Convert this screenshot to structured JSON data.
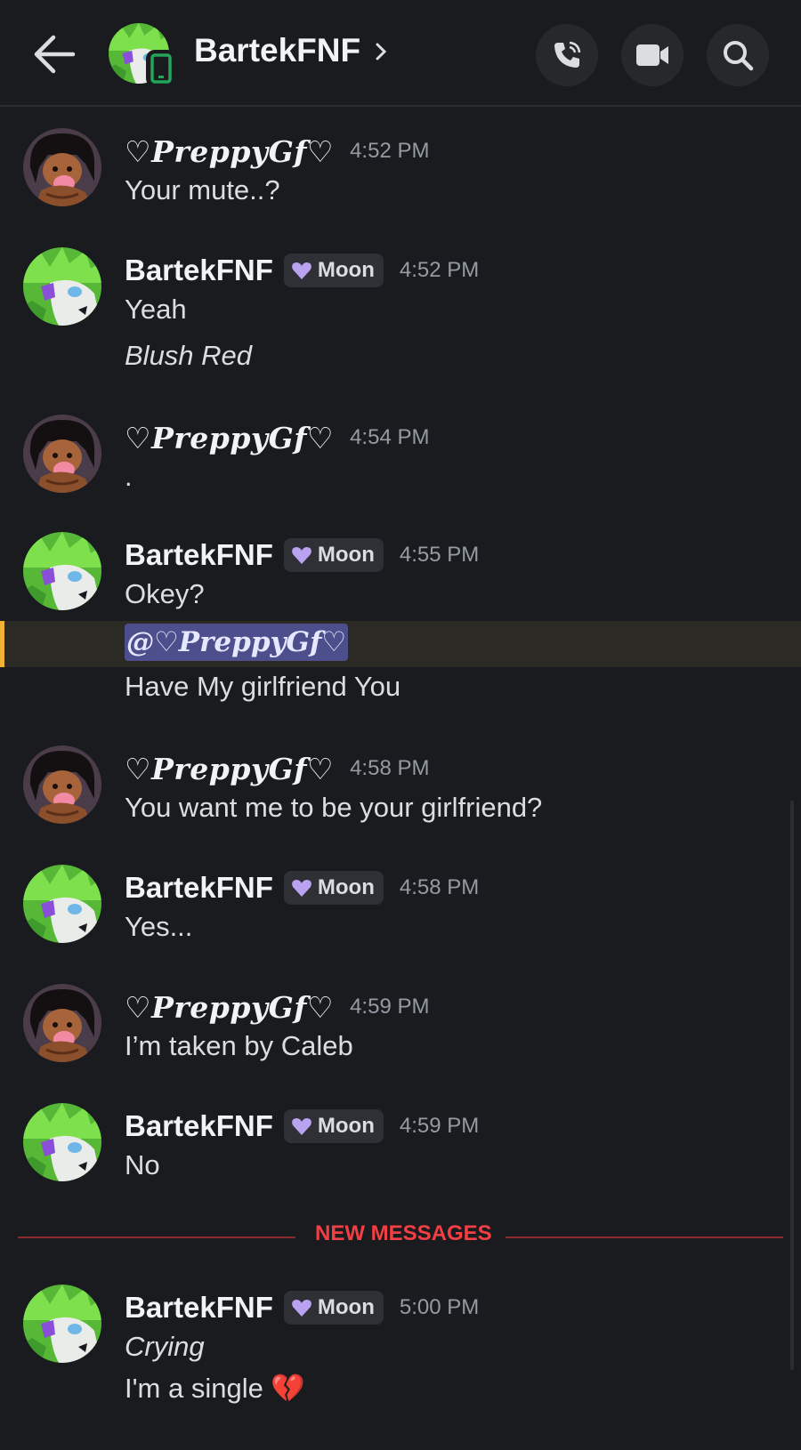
{
  "header": {
    "channel_name": "BartekFNF",
    "back_icon": "arrow-left-icon",
    "chevron_icon": "chevron-right-icon",
    "actions": [
      "voice-call-icon",
      "video-call-icon",
      "search-icon"
    ]
  },
  "users": {
    "preppy": {
      "name": "♡PreppyGf♡"
    },
    "bartek": {
      "name": "BartekFNF",
      "tag": "Moon"
    }
  },
  "messages": [
    {
      "author": "♡PreppyGf♡",
      "time": "4:52 PM",
      "lines": [
        "Your mute..?"
      ]
    },
    {
      "author": "BartekFNF",
      "tag": "Moon",
      "time": "4:52 PM",
      "lines": [
        "Yeah",
        "Blush Red"
      ]
    },
    {
      "author": "♡PreppyGf♡",
      "time": "4:54 PM",
      "lines": [
        "."
      ]
    },
    {
      "author": "BartekFNF",
      "tag": "Moon",
      "time": "4:55 PM",
      "lines": [
        "Okey?",
        "@♡PreppyGf♡",
        "Have My girlfriend You"
      ]
    },
    {
      "author": "♡PreppyGf♡",
      "time": "4:58 PM",
      "lines": [
        "You want me to be your girlfriend?"
      ]
    },
    {
      "author": "BartekFNF",
      "tag": "Moon",
      "time": "4:58 PM",
      "lines": [
        "Yes..."
      ]
    },
    {
      "author": "♡PreppyGf♡",
      "time": "4:59 PM",
      "lines": [
        "I’m taken by Caleb"
      ]
    },
    {
      "author": "BartekFNF",
      "tag": "Moon",
      "time": "4:59 PM",
      "lines": [
        "No"
      ]
    },
    {
      "author": "BartekFNF",
      "tag": "Moon",
      "time": "5:00 PM",
      "lines": [
        "Crying",
        "I'm a single 💔"
      ]
    }
  ],
  "divider": {
    "label": "NEW MESSAGES"
  },
  "colors": {
    "background": "#1a1b1f",
    "mention_highlight": "#f0b232",
    "mention_pill": "#4d4f8c",
    "new_messages": "#f23f43",
    "tag_heart": "#b9a2f0",
    "mobile_badge": "#23a55a"
  }
}
